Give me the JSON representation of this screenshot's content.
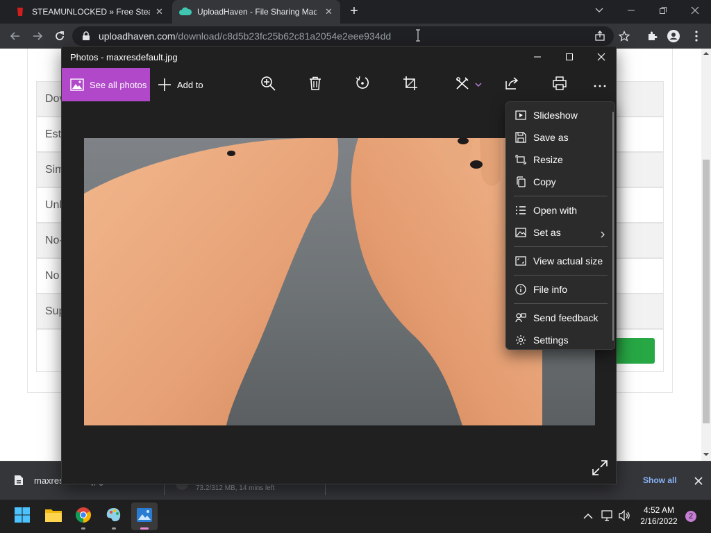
{
  "browser": {
    "tabs": [
      {
        "title": "STEAMUNLOCKED » Free Steam",
        "active": false
      },
      {
        "title": "UploadHaven - File Sharing Mad",
        "active": true
      }
    ],
    "new_tab": "+",
    "url_host": "uploadhaven.com",
    "url_path": "/download/c8d5b23fc25b62c81a2054e2eee934dd"
  },
  "webpage": {
    "rows": [
      {
        "label": "Dov",
        "shaded": true
      },
      {
        "label": "Est",
        "shaded": false
      },
      {
        "label": "Sim",
        "shaded": true
      },
      {
        "label": "Unl",
        "shaded": false
      },
      {
        "label": "No-",
        "shaded": true
      },
      {
        "label": "No",
        "shaded": false
      },
      {
        "label": "Sup",
        "shaded": true
      }
    ],
    "accent": "#28a745"
  },
  "photos": {
    "window_title": "Photos - maxresdefault.jpg",
    "see_all_label": "See all photos",
    "add_to_label": "Add to",
    "accent": "#b048c9"
  },
  "menu": {
    "items": [
      {
        "label": "Slideshow",
        "icon": "slideshow-icon"
      },
      {
        "label": "Save as",
        "icon": "save-icon"
      },
      {
        "label": "Resize",
        "icon": "resize-icon"
      },
      {
        "label": "Copy",
        "icon": "copy-icon"
      },
      {
        "label": "Open with",
        "icon": "open-with-icon"
      },
      {
        "label": "Set as",
        "icon": "set-as-icon",
        "submenu": true
      },
      {
        "label": "View actual size",
        "icon": "actual-size-icon"
      },
      {
        "label": "File info",
        "icon": "info-icon"
      },
      {
        "label": "Send feedback",
        "icon": "feedback-icon"
      },
      {
        "label": "Settings",
        "icon": "gear-icon"
      }
    ]
  },
  "downloads": {
    "file_name": "maxres",
    "file_name_tail": "jpg",
    "progress_text": "73.2/312 MB, 14 mins left",
    "show_all": "Show all"
  },
  "taskbar": {
    "time": "4:52 AM",
    "date": "2/16/2022",
    "notification_count": "2"
  }
}
